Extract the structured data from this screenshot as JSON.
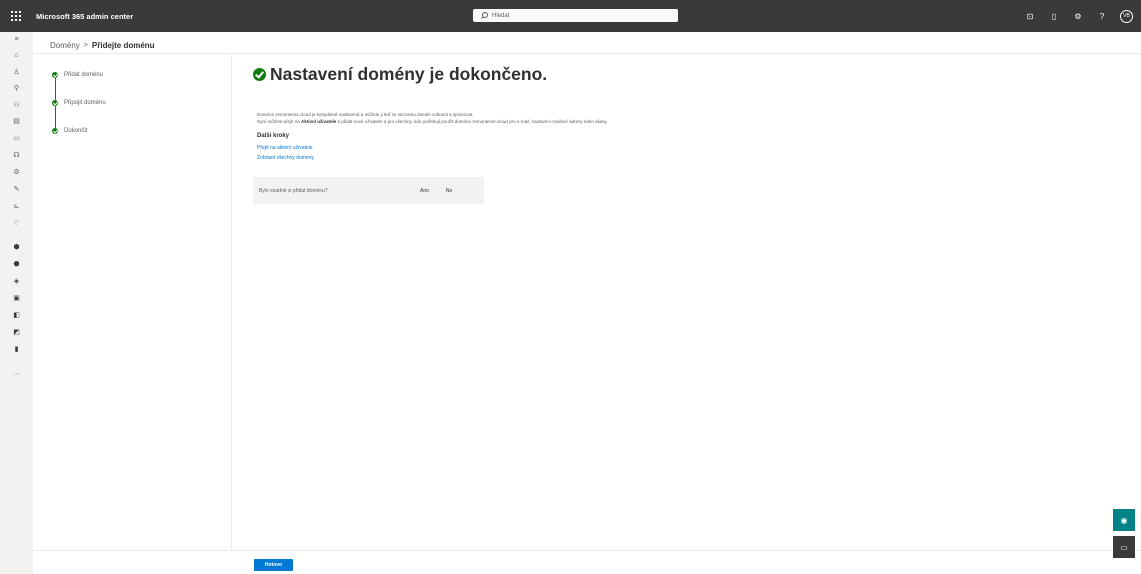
{
  "header": {
    "app_title": "Microsoft 365 admin center",
    "search_placeholder": "Hledat",
    "icons": [
      "terminal-icon",
      "document-icon",
      "settings-icon",
      "help-icon"
    ],
    "avatar_initials": "VB"
  },
  "rail": {
    "icons": [
      {
        "name": "menu-icon",
        "glyph": "≡",
        "dark": false
      },
      {
        "name": "home-icon",
        "glyph": "⌂",
        "dark": false
      },
      {
        "name": "users-icon",
        "glyph": "♙",
        "dark": false
      },
      {
        "name": "teams-icon",
        "glyph": "⚲",
        "dark": false
      },
      {
        "name": "roles-icon",
        "glyph": "⚇",
        "dark": false
      },
      {
        "name": "billing-icon",
        "glyph": "▤",
        "dark": false
      },
      {
        "name": "resources-icon",
        "glyph": "▭",
        "dark": false
      },
      {
        "name": "support-icon",
        "glyph": "☊",
        "dark": false
      },
      {
        "name": "settings-icon",
        "glyph": "⚙",
        "dark": false
      },
      {
        "name": "setup-icon",
        "glyph": "✎",
        "dark": false
      },
      {
        "name": "reports-icon",
        "glyph": "⊾",
        "dark": false
      },
      {
        "name": "health-icon",
        "glyph": "♡",
        "dark": false
      },
      {
        "name": "security-icon",
        "glyph": "⬢",
        "dark": true
      },
      {
        "name": "compliance-icon",
        "glyph": "⬣",
        "dark": true
      },
      {
        "name": "endpoint-icon",
        "glyph": "◈",
        "dark": true
      },
      {
        "name": "exchange-icon",
        "glyph": "▣",
        "dark": true
      },
      {
        "name": "sharepoint-icon",
        "glyph": "◧",
        "dark": true
      },
      {
        "name": "teams-admin-icon",
        "glyph": "◩",
        "dark": true
      },
      {
        "name": "all-admin-centers-icon",
        "glyph": "▮",
        "dark": true
      },
      {
        "name": "more-icon",
        "glyph": "···",
        "dark": false
      }
    ]
  },
  "breadcrumb": {
    "parent": "Domény",
    "separator": ">",
    "current": "Přidejte doménu"
  },
  "wizard": {
    "steps": [
      {
        "label": "Přidat doménu"
      },
      {
        "label": "Připojit doménu"
      },
      {
        "label": "Dokončit"
      }
    ]
  },
  "main": {
    "title": "Nastavení domény je dokončeno.",
    "desc_line1": "Doména zemonteraz.cloud je kompletně nastavená a můžete ji teď ze seznamu domén zobrazit a spravovat.",
    "desc_line2_pre": "Nyní můžete přejít na ",
    "desc_line2_bold": "Aktivní uživatele",
    "desc_line2_post": " a přidat nové uživatele a pro všechny, kdo potřebují použít doménu zemonteraz.cloud pro e-mail, nastavit e-mailové adresy nebo aliasy.",
    "next_steps_title": "Další kroky",
    "links": [
      "Přejít na aktivní uživatele",
      "Zobrazit všechny domény"
    ],
    "feedback": {
      "question": "Bylo snadné si přidat doménu?",
      "yes": "Ano",
      "no": "Ne"
    },
    "done_button": "Hotovo"
  },
  "accent_colors": {
    "primary": "#0078d4",
    "success": "#107c10",
    "topbar": "#3b3a39",
    "help_button": "#038387"
  }
}
